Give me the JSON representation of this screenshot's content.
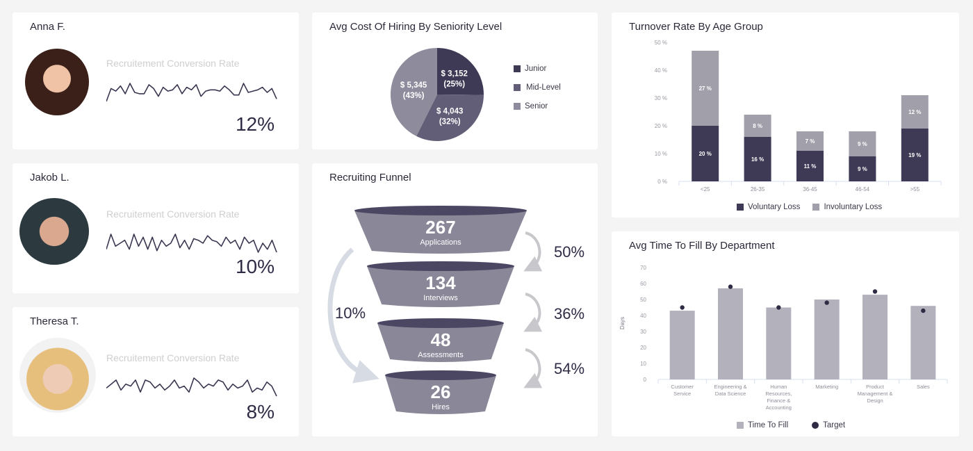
{
  "people": [
    {
      "name": "Anna F.",
      "metric_label": "Recruitement Conversion Rate",
      "value": "12%",
      "sparkline": [
        18,
        8,
        10,
        6,
        12,
        4,
        11,
        12,
        12,
        5,
        8,
        14,
        7,
        10,
        9,
        5,
        12,
        7,
        9,
        5,
        14,
        10,
        9,
        9,
        10,
        6,
        9,
        13,
        13,
        4,
        11,
        10,
        9,
        7,
        11,
        8,
        16
      ]
    },
    {
      "name": "Jakob L.",
      "metric_label": "Recruitement Conversion Rate",
      "value": "10%",
      "sparkline": [
        16,
        6,
        14,
        12,
        10,
        16,
        6,
        14,
        8,
        16,
        8,
        17,
        10,
        14,
        12,
        6,
        15,
        10,
        16,
        9,
        10,
        12,
        7,
        10,
        11,
        14,
        8,
        12,
        10,
        16,
        8,
        12,
        10,
        18,
        12,
        16,
        10,
        18
      ]
    },
    {
      "name": "Theresa T.",
      "metric_label": "Recruitement Conversion Rate",
      "value": "8%",
      "sparkline": [
        12,
        10,
        8,
        13,
        10,
        11,
        8,
        14,
        8,
        9,
        12,
        10,
        13,
        11,
        8,
        12,
        11,
        14,
        7,
        9,
        12,
        10,
        11,
        8,
        9,
        13,
        10,
        12,
        11,
        8,
        14,
        12,
        13,
        9,
        11,
        16
      ]
    }
  ],
  "funnel": {
    "title": "Recruiting Funnel",
    "stages": [
      {
        "value": "267",
        "label": "Applications"
      },
      {
        "value": "134",
        "label": "Interviews"
      },
      {
        "value": "48",
        "label": "Assessments"
      },
      {
        "value": "26",
        "label": "Hires"
      }
    ],
    "conversions": [
      "50%",
      "36%",
      "54%"
    ],
    "overall_conversion": "10%"
  },
  "chart_data": [
    {
      "type": "pie",
      "title": "Avg Cost Of Hiring By Seniority Level",
      "categories": [
        "Junior",
        "Mid-Level",
        "Senior"
      ],
      "values": [
        3152,
        4043,
        5345
      ],
      "labels": [
        "$ 3,152",
        "$ 4,043",
        "$ 5,345"
      ],
      "percent_labels": [
        "(25%)",
        "(32%)",
        "(43%)"
      ],
      "colors": [
        "#3e3a55",
        "#625e77",
        "#8e8b9c"
      ],
      "legend": "right"
    },
    {
      "type": "bar",
      "stacked": true,
      "title": "Turnover Rate By Age Group",
      "categories": [
        "<25",
        "26-35",
        "36-45",
        "46-54",
        ">55"
      ],
      "series": [
        {
          "name": "Voluntary Loss",
          "values": [
            20,
            16,
            11,
            9,
            19
          ],
          "color": "#3e3a55"
        },
        {
          "name": "Involuntary Loss",
          "values": [
            27,
            8,
            7,
            9,
            12
          ],
          "color": "#a19fa9"
        }
      ],
      "yticks": [
        "0 %",
        "10 %",
        "20 %",
        "30 %",
        "40 %",
        "50 %"
      ],
      "ylim": [
        0,
        50
      ],
      "value_suffix": " %",
      "legend": "bottom"
    },
    {
      "type": "bar",
      "title": "Avg Time To Fill By Department",
      "ylabel": "Days",
      "categories": [
        [
          "Customer",
          "Service"
        ],
        [
          "Engineering &",
          "Data Science"
        ],
        [
          "Human",
          "Resources,",
          "Finance &",
          "Accounting"
        ],
        [
          "Marketing"
        ],
        [
          "Product",
          "Management &",
          "Design"
        ],
        [
          "Sales"
        ]
      ],
      "series": [
        {
          "name": "Time To Fill",
          "kind": "bar",
          "values": [
            43,
            57,
            45,
            50,
            53,
            46
          ],
          "color": "#b3b1bc"
        },
        {
          "name": "Target",
          "kind": "dot",
          "values": [
            45,
            58,
            45,
            48,
            55,
            43
          ],
          "color": "#2f2b45"
        }
      ],
      "yticks": [
        "0",
        "10",
        "20",
        "30",
        "40",
        "50",
        "60",
        "70"
      ],
      "ylim": [
        0,
        70
      ],
      "legend": "bottom"
    }
  ]
}
